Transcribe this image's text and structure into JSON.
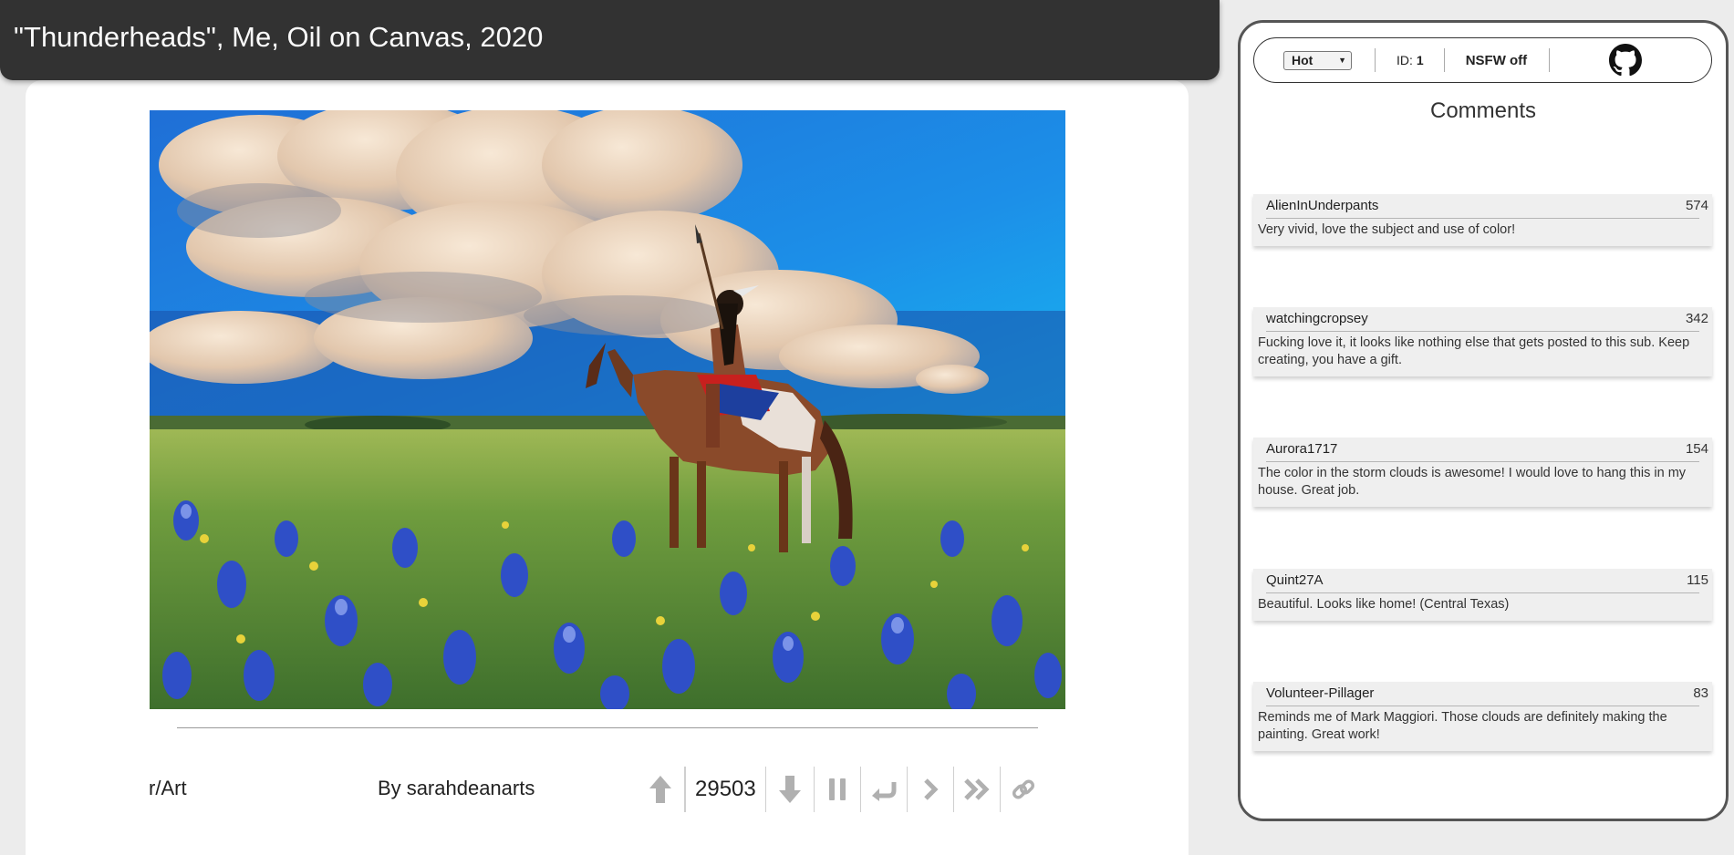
{
  "post": {
    "title": "\"Thunderheads\", Me, Oil on Canvas, 2020",
    "subreddit": "r/Art",
    "author_prefix": "By",
    "author": "sarahdeanarts",
    "score": "29503"
  },
  "artwork": {
    "description_icon": "painting-image"
  },
  "toolbar": {
    "sort_value": "Hot",
    "id_label": "ID:",
    "id_value": "1",
    "nsfw_label": "NSFW off"
  },
  "comments_heading": "Comments",
  "comments": [
    {
      "author": "AlienInUnderpants",
      "score": "574",
      "text": "Very vivid, love the subject and use of color!"
    },
    {
      "author": "watchingcropsey",
      "score": "342",
      "text": "Fucking love it, it looks like nothing else that gets posted to this sub. Keep creating, you have a gift."
    },
    {
      "author": "Aurora1717",
      "score": "154",
      "text": "The color in the storm clouds is awesome! I would love to hang this in my house. Great job."
    },
    {
      "author": "Quint27A",
      "score": "115",
      "text": "Beautiful. Looks like home! (Central Texas)"
    },
    {
      "author": "Volunteer-Pillager",
      "score": "83",
      "text": "Reminds me of Mark Maggiori. Those clouds are definitely making the painting. Great work!"
    }
  ],
  "colors": {
    "title_bar": "#323232",
    "icon_gray": "#b0b0b0",
    "panel_border": "#555555"
  }
}
